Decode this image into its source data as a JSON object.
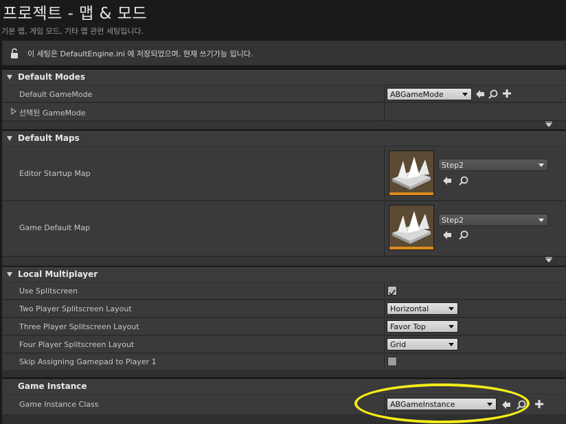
{
  "header": {
    "title": "프로젝트 - 맵 & 모드",
    "subtitle": "기본 맵, 게임 모드, 기타 맵 관련 세팅입니다."
  },
  "notice": {
    "text": "이 세팅은 DefaultEngine.ini 에 저장되었으며, 현재 쓰기가능 입니다."
  },
  "sections": {
    "default_modes": {
      "title": "Default Modes",
      "default_gamemode_label": "Default GameMode",
      "default_gamemode_value": "ABGameMode",
      "selected_gamemode_label": "선택된 GameMode"
    },
    "default_maps": {
      "title": "Default Maps",
      "editor_startup_label": "Editor Startup Map",
      "editor_startup_value": "Step2",
      "game_default_label": "Game Default Map",
      "game_default_value": "Step2"
    },
    "local_multiplayer": {
      "title": "Local Multiplayer",
      "use_splitscreen_label": "Use Splitscreen",
      "use_splitscreen_checked": true,
      "two_player_label": "Two Player Splitscreen Layout",
      "two_player_value": "Horizontal",
      "three_player_label": "Three Player Splitscreen Layout",
      "three_player_value": "Favor Top",
      "four_player_label": "Four Player Splitscreen Layout",
      "four_player_value": "Grid",
      "skip_gamepad_label": "Skip Assigning Gamepad to Player 1",
      "skip_gamepad_checked": false
    },
    "game_instance": {
      "title": "Game Instance",
      "class_label": "Game Instance Class",
      "class_value": "ABGameInstance"
    }
  },
  "colors": {
    "highlight": "#f4ec1a",
    "thumbnail_accent": "#e08a1e"
  }
}
